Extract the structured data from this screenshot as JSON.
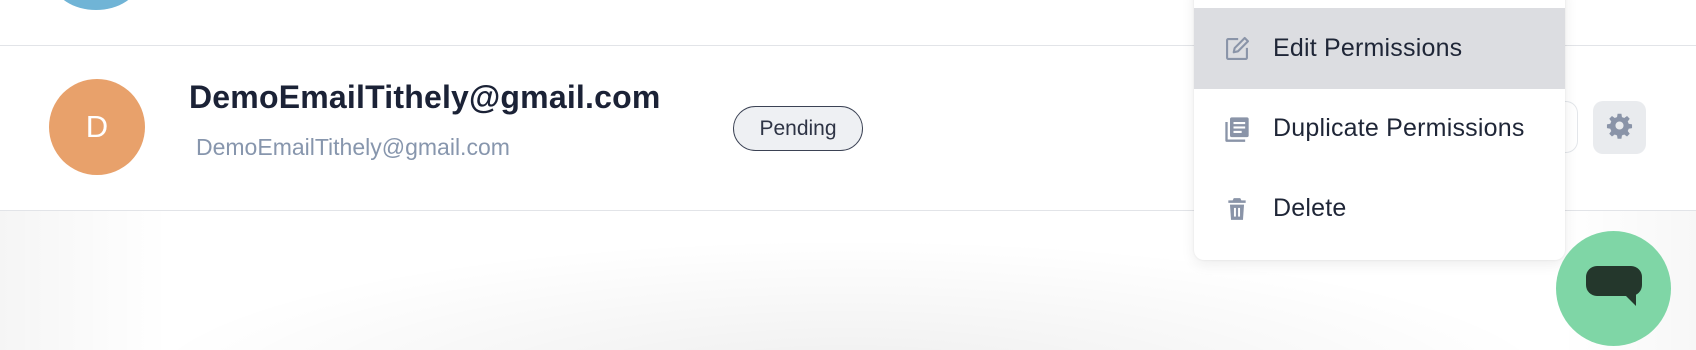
{
  "user": {
    "avatar_initial": "D",
    "name": "DemoEmailTithely@gmail.com",
    "email": "DemoEmailTithely@gmail.com",
    "status": "Pending"
  },
  "menu": {
    "items": [
      {
        "label": "Edit Permissions",
        "icon": "edit-icon"
      },
      {
        "label": "Duplicate Permissions",
        "icon": "duplicate-icon"
      },
      {
        "label": "Delete",
        "icon": "trash-icon"
      }
    ]
  },
  "icons": {
    "settings": "gear-icon",
    "chat": "chat-bubble-icon"
  },
  "colors": {
    "avatar_above": "#70b4d6",
    "avatar_user": "#e8a16b",
    "chat_launcher": "#7fd6a6",
    "menu_active": "#dcdde1",
    "icon_grey": "#8a94a8",
    "text_primary": "#1b2236",
    "text_secondary": "#8796ad"
  }
}
